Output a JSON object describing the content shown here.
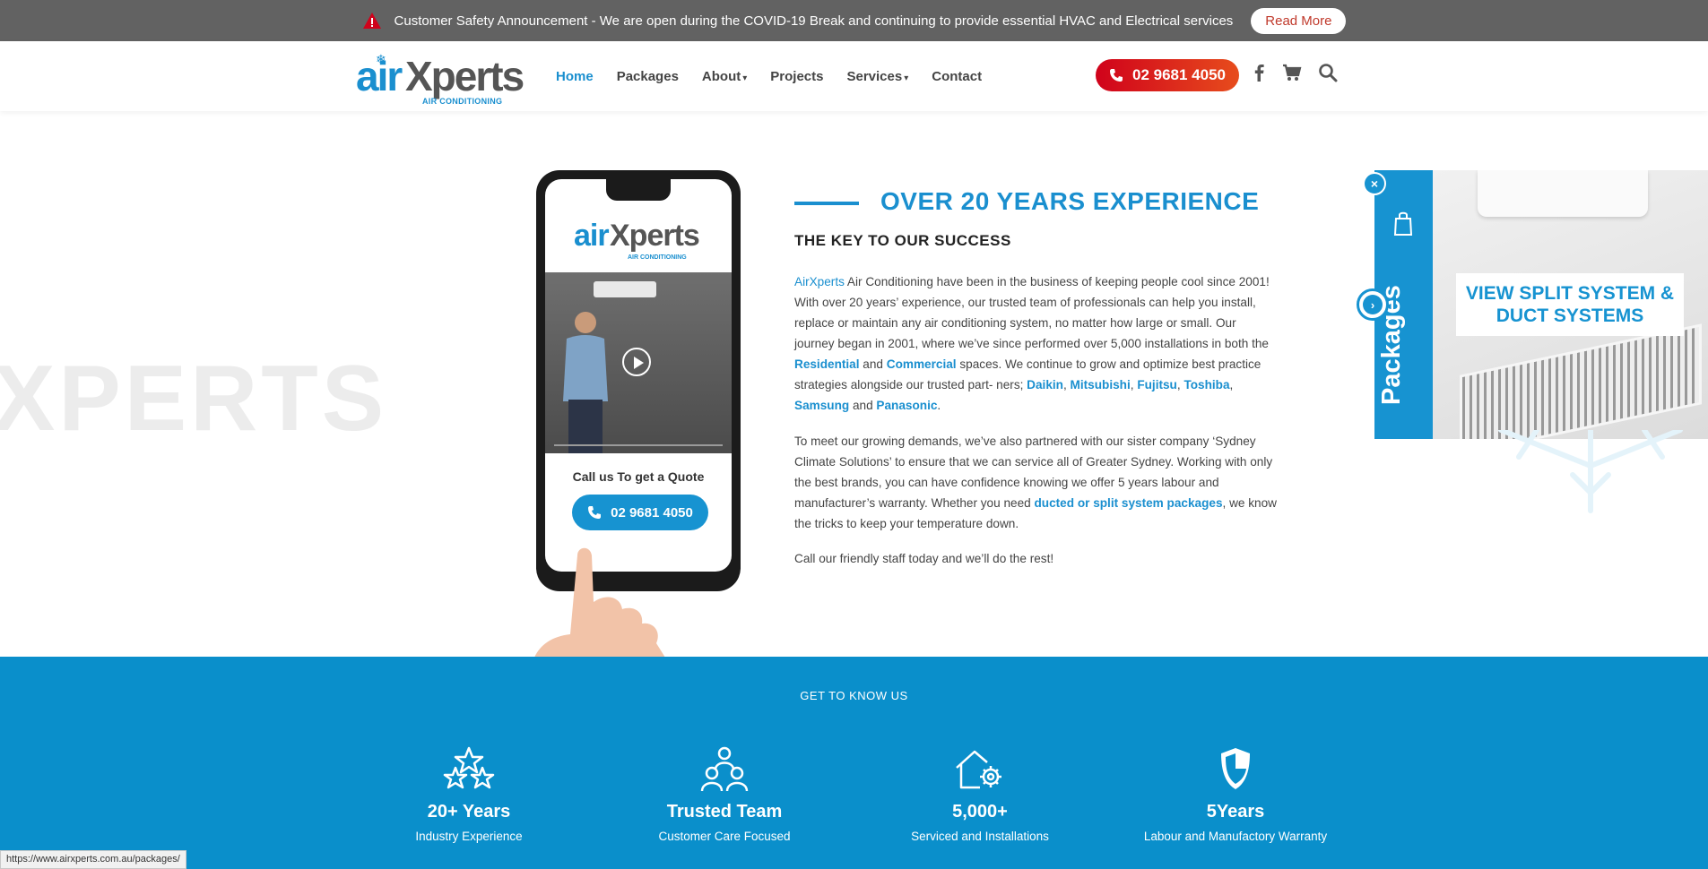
{
  "announcement": {
    "text": "Customer Safety Announcement - We are open during the COVID-19 Break and continuing to provide essential HVAC and Electrical services",
    "button": "Read More"
  },
  "logo": {
    "part1": "air",
    "part2": "Xperts",
    "tagline": "AIR CONDITIONING"
  },
  "nav": {
    "items": [
      "Home",
      "Packages",
      "About",
      "Projects",
      "Services",
      "Contact"
    ],
    "active": "Home"
  },
  "header": {
    "phone": "02 9681 4050"
  },
  "watermark": "XPERTS",
  "phone_mockup": {
    "cta_text": "Call us To get a Quote",
    "cta_phone": "02 9681 4050"
  },
  "about": {
    "title": "OVER 20 YEARS EXPERIENCE",
    "subtitle": "THE KEY TO OUR SUCCESS",
    "p1": {
      "brand": "AirXperts",
      "t1": " Air Conditioning have been in the business of keeping people cool since 2001! With over 20 years’ experience, our trusted team of professionals can help you install, replace or maintain any air conditioning system, no matter how large or small. Our journey began in 2001, where we’ve since performed over 5,000 installations in both the ",
      "residential": "Residential",
      "and1": " and ",
      "commercial": "Commercial",
      "t2": " spaces. We continue to grow and optimize best practice strategies alongside our trusted part- ners; ",
      "daikin": "Daikin",
      "mitsubishi": "Mitsubishi",
      "fujitsu": "Fujitsu",
      "toshiba": "Toshiba",
      "samsung": "Samsung",
      "and2": " and ",
      "panasonic": "Panasonic",
      "sep": ", ",
      "end": "."
    },
    "p2": {
      "t1": "To meet our growing demands, we’ve also partnered with our sister company ‘Sydney Climate Solutions’ to ensure that we can service all of Greater Sydney. Working with only the best brands, you can have confidence knowing we offer 5 years labour and manufacturer’s warranty. Whether you need ",
      "link": "ducted or split system packages",
      "t2": ", we know the tricks to keep your temperature down."
    },
    "p3": "Call our friendly staff today and we’ll do the rest!"
  },
  "packages_popup": {
    "tab_label": "Packages",
    "cta": "VIEW SPLIT SYSTEM & DUCT SYSTEMS",
    "close": "×"
  },
  "band": {
    "kicker": "GET TO KNOW US",
    "stats": [
      {
        "icon": "stars-icon",
        "num": "20+ Years",
        "label": "Industry Experience"
      },
      {
        "icon": "team-icon",
        "num": "Trusted Team",
        "label": "Customer Care Focused"
      },
      {
        "icon": "house-gear-icon",
        "num": "5,000+",
        "label": "Serviced and Installations"
      },
      {
        "icon": "shield-icon",
        "num": "5Years",
        "label": "Labour and Manufactory Warranty"
      }
    ]
  },
  "status_url": "https://www.airxperts.com.au/packages/",
  "colors": {
    "brand_blue": "#1a8fcf",
    "band_blue": "#0a8fcb",
    "phone_red": "#d0021b",
    "announce_gray": "#626262"
  }
}
